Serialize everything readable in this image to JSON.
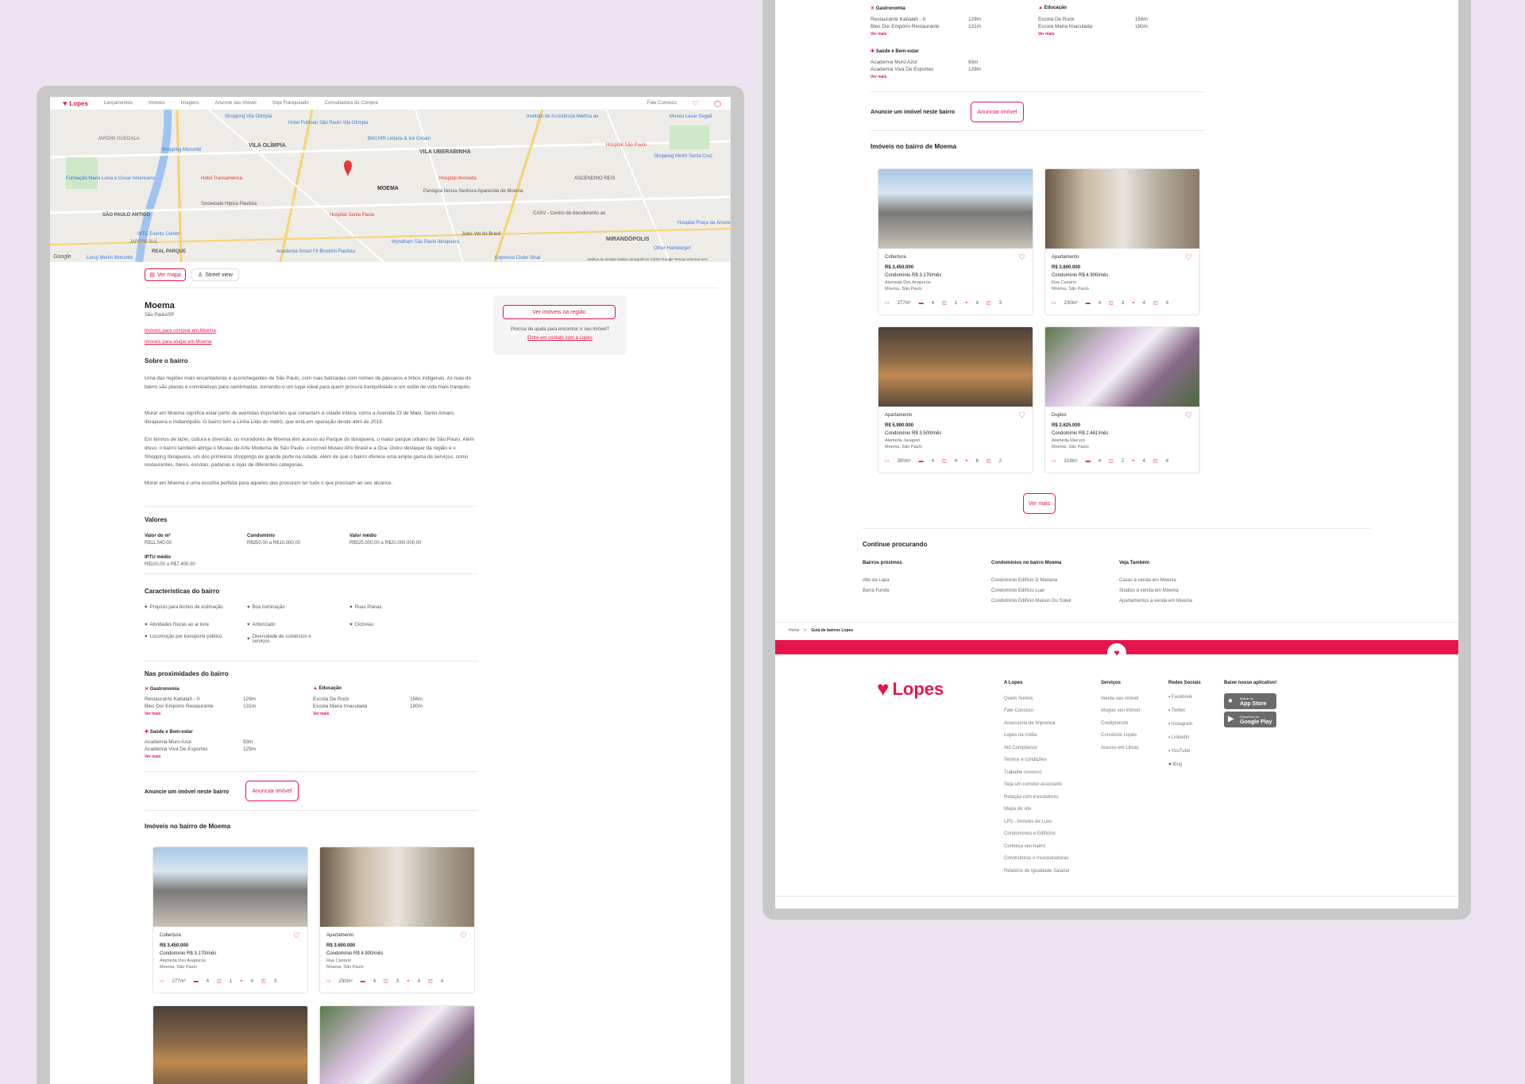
{
  "nav": {
    "logo": "Lopes",
    "items": [
      "Lançamentos",
      "Imóveis",
      "Imagens",
      "Anuncie seu imóvel",
      "Seja Franqueado",
      "Consultadora de Compra"
    ],
    "contact": "Fale Conosco"
  },
  "map": {
    "labels": [
      "VILA OLÍMPIA",
      "VILA UBERABINHA",
      "MOEMA",
      "ASCENDINO REIS",
      "SÃO PAULO ANTIGO",
      "MIRANDÓPOLIS",
      "REAL PARQUE",
      "JARDIM GUEDALA",
      "JARDIM SUL"
    ],
    "pois": [
      "Shopping Vila Olímpia",
      "Hotel Pullman São Paulo Vila Olímpia",
      "Instituto de Assistência Médica ao",
      "Museu Lasar Segall",
      "Hospital São Paulo",
      "Hotel Transamérica",
      "Hospital Alvorada",
      "Shopping Metrô Santa Cruz",
      "Sociedade Hípica Paulista",
      "Paróquia Nossa Senhora Aparecida de Moema",
      "Hospital Santa Paula",
      "CASV - Centro de Atendimento ao",
      "Hospital Praça da Árvore",
      "Wyndham São Paulo Ibirapuera",
      "Academia Smart Fit Brooklin Paulista",
      "Leroy Merlin Morumbi",
      "WTC Events Center",
      "Shopping Morumbi",
      "Fundação Maria Luisa e Oscar Americano",
      "Jules Vet do Brasil",
      "Shopping Ibirapuera",
      "Expresso Clube Sinai",
      "Ofner Hamburger",
      "BACHIR Leitaria & Ice Cream"
    ],
    "attribution": "Atalhos do teclado   Dados cartográficos ©2024 Google   Termos   Informar erro",
    "google": "Google",
    "pin_label": "MOEMA"
  },
  "actions": {
    "ver_mapa": "Ver mapa",
    "street_view": "Street view"
  },
  "bairro": {
    "name": "Moema",
    "city": "São Paulo/SP",
    "link_comprar": "Imóveis para comprar em Moema",
    "link_alugar": "Imóveis para alugar em Moema",
    "sobre_title": "Sobre o bairro",
    "p1": "Uma das regiões mais encantadoras e aconchegantes de São Paulo, com ruas batizadas com nomes de pássaros e tribos indígenas. As ruas do bairro são planas e convidativas para caminhadas, tornando-o um lugar ideal para quem procura tranquilidade e um estilo de vida mais tranquilo.",
    "p2": "Morar em Moema significa estar perto de avenidas importantes que conectam a cidade inteira, como a Avenida 23 de Maio, Santo Amaro, Ibirapuera e Indianópolis. O bairro tem a Linha Lilás do metrô, que está em operação desde abril de 2018.",
    "p3": "Em termos de lazer, cultura e diversão, os moradores de Moema têm acesso ao Parque do Ibirapuera, o maior parque urbano de São Paulo. Além disso, o bairro também abriga o Museu de Arte Moderna de São Paulo, o incrível Museu Afro Brasil e a Oca. Outro destaque da região é o Shopping Ibirapuera, um dos primeiros shoppings de grande porte na cidade. Além de que o bairro oferece uma ampla gama de serviços, como restaurantes, bares, escolas, padarias e lojas de diferentes categorias.",
    "p4": "Morar em Moema é uma escolha perfeita para aqueles que procuram ter tudo o que precisam ao seu alcance."
  },
  "side": {
    "btn": "Ver imóveis na região",
    "help": "Precisa de ajuda para encontrar o seu imóvel?",
    "contact": "Entre em contato com a Lopes"
  },
  "valores": {
    "title": "Valores",
    "items": [
      {
        "label": "Valor do m²",
        "value": "R$11.540,00"
      },
      {
        "label": "Condomínio",
        "value": "R$350,00 a R$10.000,00"
      },
      {
        "label": "Valor médio",
        "value": "R$525.000,00 a R$20.000.000,00"
      },
      {
        "label": "IPTU médio",
        "value": "R$100,00 a R$7.400,00"
      }
    ]
  },
  "caracteristicas": {
    "title": "Características do bairro",
    "items": [
      "Propício para bichos de estimação",
      "Boa iluminação",
      "Ruas Planas",
      "Atividades físicas ao ar livre",
      "Arborizado",
      "Ciclovias",
      "Locomoção por transporte público",
      "Diversidade de comércios e serviços"
    ]
  },
  "proximidades": {
    "title": "Nas proximidades do bairro",
    "ver_mais": "Ver mais",
    "groups": [
      {
        "title": "Gastronomia",
        "rows": [
          {
            "name": "Restaurante Kabalah - II",
            "dist": "129m"
          },
          {
            "name": "Bles Dor Empório Restaurante",
            "dist": "131m"
          }
        ]
      },
      {
        "title": "Educação",
        "rows": [
          {
            "name": "Escola De Rock",
            "dist": "156m"
          },
          {
            "name": "Escola Maria Imaculada",
            "dist": "180m"
          }
        ]
      },
      {
        "title": "Saúde e Bem-estar",
        "rows": [
          {
            "name": "Academia Muro Azul",
            "dist": "93m"
          },
          {
            "name": "Academia Viva De Esportes",
            "dist": "129m"
          }
        ]
      }
    ]
  },
  "anuncie": {
    "text": "Anuncie um imóvel neste bairro",
    "btn": "Anunciar imóvel"
  },
  "imoveis": {
    "title": "Imóveis no bairro de Moema",
    "ver_mais": "Ver mais",
    "cards": [
      {
        "type": "Cobertura",
        "price": "R$ 3.450.000",
        "condo": "Condomínio R$ 3.170/mês",
        "street": "Alameda Dos Anapurús",
        "hood": "Moema, São Paulo",
        "area": "277m²",
        "beds": "4",
        "suites": "1",
        "baths": "4",
        "parking": "3"
      },
      {
        "type": "Apartamento",
        "price": "R$ 3.600.000",
        "condo": "Condomínio R$ 4.900/mês",
        "street": "Rua Canário",
        "hood": "Moema, São Paulo",
        "area": "230m²",
        "beds": "4",
        "suites": "3",
        "baths": "4",
        "parking": "4"
      },
      {
        "type": "Apartamento",
        "price": "R$ 5.990.000",
        "condo": "Condomínio R$ 3.500/mês",
        "street": "Alameda Jauaperi",
        "hood": "Moema, São Paulo",
        "area": "300m²",
        "beds": "4",
        "suites": "4",
        "baths": "6",
        "parking": "2"
      },
      {
        "type": "Duplex",
        "price": "R$ 2.625.000",
        "condo": "Condomínio R$ 2.461/mês",
        "street": "Alameda Macuco",
        "hood": "Moema, São Paulo",
        "area": "219m²",
        "beds": "4",
        "suites": "2",
        "baths": "4",
        "parking": "4"
      }
    ]
  },
  "continue": {
    "title": "Continue procurando",
    "cols": [
      {
        "title": "Bairros próximos",
        "links": [
          "Alto da Lapa",
          "Barra Funda"
        ]
      },
      {
        "title": "Condomínios no bairro Moema",
        "links": [
          "Condomínio Edifício D Mariana",
          "Condomínio Edifício Luar",
          "Condomínio Edifício Maison Du Soleil"
        ]
      },
      {
        "title": "Veja Também",
        "links": [
          "Casas à venda em Moema",
          "Studios à venda em Moema",
          "Apartamentos à venda em Moema"
        ]
      }
    ]
  },
  "breadcrumb": {
    "home": "Home",
    "sep": ">",
    "current": "Guia de bairros Lopes"
  },
  "footer": {
    "logo": "Lopes",
    "alopes": {
      "title": "A Lopes",
      "links": [
        "Quem Somos",
        "Fale Conosco",
        "Assessoria de Imprensa",
        "Lopes na mídia",
        "Alô Compliance",
        "Termos e condições",
        "Trabalhe conosco",
        "Seja um corretor associado",
        "Relação com investidores",
        "Mapa do site",
        "LPS - Imóveis de Luxo",
        "Condomínios e Edifícios",
        "Conheça seu bairro",
        "Construtoras e Incorporadoras",
        "Relatório de Igualdade Salarial"
      ]
    },
    "servicos": {
      "title": "Serviços",
      "links": [
        "Venda seu imóvel",
        "Alugue seu imóvel",
        "Crediproncto",
        "Consórcio Lopes",
        "Acesso em Libras"
      ]
    },
    "redes": {
      "title": "Redes Sociais",
      "links": [
        "Facebook",
        "Twitter",
        "Instagram",
        "LinkedIn",
        "YouTube",
        "Blog"
      ]
    },
    "app": {
      "title": "Baixe nosso aplicativo!",
      "appstore": "App Store",
      "appstore_small": "Baixar na",
      "googleplay": "Google Play",
      "googleplay_small": "Disponível no"
    }
  },
  "colors": {
    "accent": "#e5154a",
    "frame": "#c8c8c8",
    "background": "#ebe3ef"
  }
}
